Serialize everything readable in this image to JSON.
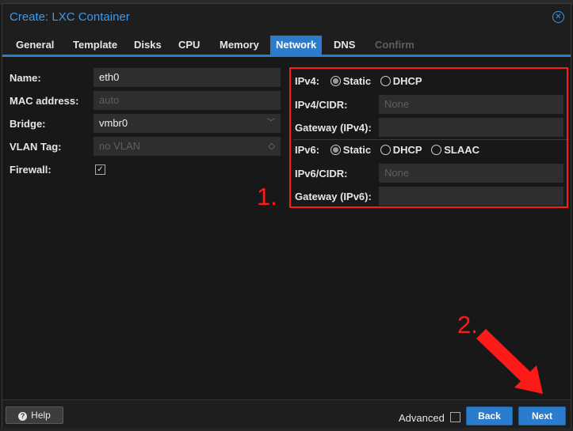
{
  "dialog": {
    "title": "Create: LXC Container"
  },
  "tabs": [
    {
      "label": "General",
      "state": "normal"
    },
    {
      "label": "Template",
      "state": "normal"
    },
    {
      "label": "Disks",
      "state": "normal"
    },
    {
      "label": "CPU",
      "state": "normal"
    },
    {
      "label": "Memory",
      "state": "normal"
    },
    {
      "label": "Network",
      "state": "active"
    },
    {
      "label": "DNS",
      "state": "normal"
    },
    {
      "label": "Confirm",
      "state": "disabled"
    }
  ],
  "network_left": {
    "name": {
      "label": "Name:",
      "value": "eth0"
    },
    "mac": {
      "label": "MAC address:",
      "placeholder": "auto"
    },
    "bridge": {
      "label": "Bridge:",
      "value": "vmbr0"
    },
    "vlan": {
      "label": "VLAN Tag:",
      "placeholder": "no VLAN"
    },
    "firewall": {
      "label": "Firewall:",
      "checked": true
    }
  },
  "network_right": {
    "ipv4": {
      "label": "IPv4:",
      "options": [
        "Static",
        "DHCP"
      ],
      "selected": "Static"
    },
    "ipv4_cidr": {
      "label": "IPv4/CIDR:",
      "placeholder": "None"
    },
    "gateway4": {
      "label": "Gateway (IPv4):",
      "value": ""
    },
    "ipv6": {
      "label": "IPv6:",
      "options": [
        "Static",
        "DHCP",
        "SLAAC"
      ],
      "selected": "Static"
    },
    "ipv6_cidr": {
      "label": "IPv6/CIDR:",
      "placeholder": "None"
    },
    "gateway6": {
      "label": "Gateway (IPv6):",
      "value": ""
    }
  },
  "annotations": {
    "step1": "1.",
    "step2": "2."
  },
  "footer": {
    "help_label": "Help",
    "advanced_label": "Advanced",
    "advanced_checked": false,
    "back_label": "Back",
    "next_label": "Next"
  },
  "colors": {
    "accent": "#2b7ccc",
    "title": "#3d9be9",
    "annotation": "#ff1a1a"
  },
  "icons": {
    "close": "close-circle-icon",
    "help": "question-circle-icon",
    "chevron": "chevron-down-icon",
    "spinner": "spinner-icon",
    "check": "checkmark-icon",
    "arrow": "red-arrow-icon"
  }
}
